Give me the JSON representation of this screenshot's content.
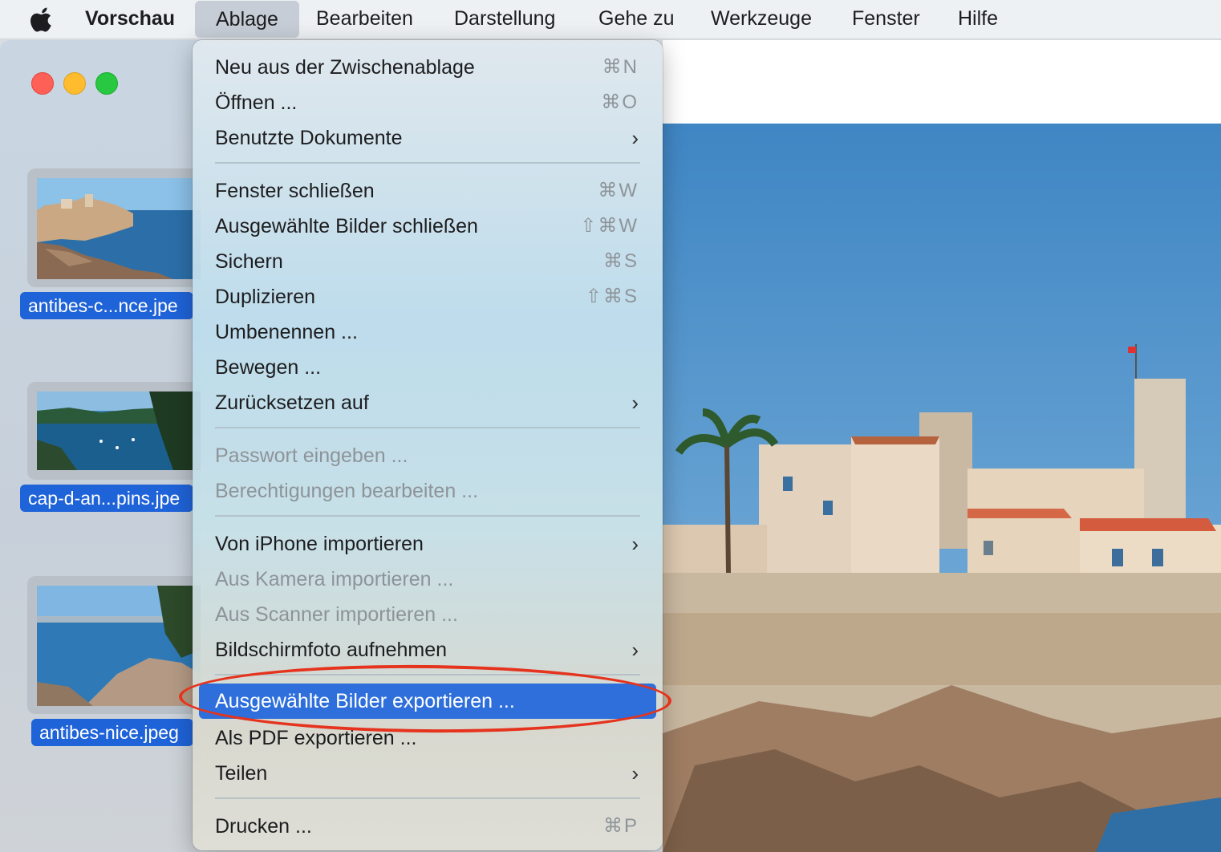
{
  "menubar": {
    "app_name": "Vorschau",
    "items": [
      "Ablage",
      "Bearbeiten",
      "Darstellung",
      "Gehe zu",
      "Werkzeuge",
      "Fenster",
      "Hilfe"
    ]
  },
  "sidebar": {
    "files": [
      {
        "label": "antibes-c...nce.jpe"
      },
      {
        "label": "cap-d-an...pins.jpe"
      },
      {
        "label": "antibes-nice.jpeg"
      }
    ]
  },
  "menu": {
    "items": [
      {
        "label": "Neu aus der Zwischenablage",
        "shortcut": "⌘N"
      },
      {
        "label": "Öffnen ...",
        "shortcut": "⌘O"
      },
      {
        "label": "Benutzte Dokumente",
        "submenu": true
      },
      {
        "label": "Fenster schließen",
        "shortcut": "⌘W"
      },
      {
        "label": "Ausgewählte Bilder schließen",
        "shortcut": "⇧⌘W"
      },
      {
        "label": "Sichern",
        "shortcut": "⌘S"
      },
      {
        "label": "Duplizieren",
        "shortcut": "⇧⌘S"
      },
      {
        "label": "Umbenennen ..."
      },
      {
        "label": "Bewegen ..."
      },
      {
        "label": "Zurücksetzen auf",
        "submenu": true
      },
      {
        "label": "Passwort eingeben ...",
        "disabled": true
      },
      {
        "label": "Berechtigungen bearbeiten ...",
        "disabled": true
      },
      {
        "label": "Von iPhone importieren",
        "submenu": true
      },
      {
        "label": "Aus Kamera importieren ...",
        "disabled": true
      },
      {
        "label": "Aus Scanner importieren ...",
        "disabled": true
      },
      {
        "label": "Bildschirmfoto aufnehmen",
        "submenu": true
      },
      {
        "label": "Ausgewählte Bilder exportieren ...",
        "selected": true
      },
      {
        "label": "Als PDF exportieren ..."
      },
      {
        "label": "Teilen",
        "submenu": true
      },
      {
        "label": "Drucken ...",
        "shortcut": "⌘P"
      }
    ],
    "submenu_arrow": "›"
  },
  "colors": {
    "selection": "#2e6fdc",
    "highlight_ring": "#e5331d",
    "file_label": "#1f63d9"
  }
}
